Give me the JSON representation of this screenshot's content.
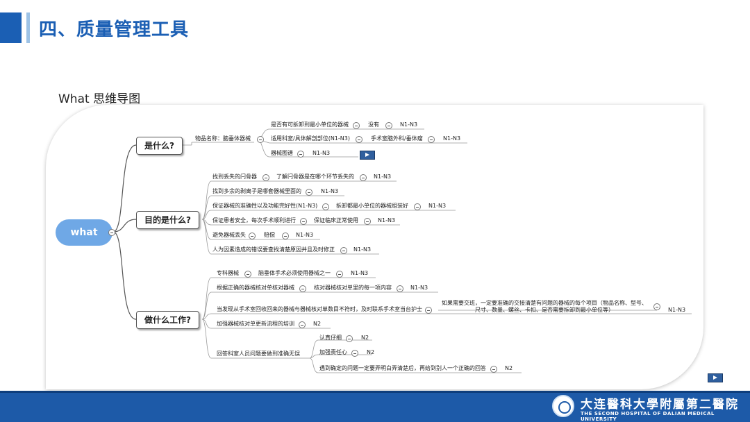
{
  "slide": {
    "title": "四、质量管理工具",
    "subtitle": "What 思维导图"
  },
  "mindmap": {
    "root": "what",
    "branch1": {
      "label": "是什么?",
      "item": "物品名称：脑垂体器械",
      "r1": "是否有可拆卸到最小单位的器械",
      "r1b": "没有",
      "r1c": "N1-N3",
      "r2": "适用科室/具体解剖部位(N1-N3)",
      "r2b": "手术室脑外科/垂体瘤",
      "r2c": "N1-N3",
      "r3": "器械图谱",
      "r3b": "N1-N3"
    },
    "branch2": {
      "label": "目的是什么?",
      "a1": "找到丢失的闩骨器",
      "a1b": "了解闩骨器是在哪个环节丢失的",
      "a1c": "N1-N3",
      "a2": "找到多余的剥离子是哪套器械里面的",
      "a2b": "N1-N3",
      "a3": "保证器械的准确性以及功能完好性(N1-N3)",
      "a3b": "拆卸都最小单位的器械组装好",
      "a3c": "N1-N3",
      "a4": "保证患者安全，每次手术顺利进行",
      "a4b": "保证临床正常使用",
      "a4c": "N1-N3",
      "a5": "避免器械丢失",
      "a5b": "赔偿",
      "a5c": "N1-N3",
      "a6": "人为因素造成的错误要查找清楚原因并且及时修正",
      "a6b": "N1-N3"
    },
    "branch3": {
      "label": "做什么工作?",
      "w1": "专科器械",
      "w1b": "脑垂体手术必须使用器械之一",
      "w1c": "N1-N3",
      "w2": "根据正确的器械核对单核对器械",
      "w2b": "核对器械核对单里的每一项内容",
      "w2c": "N1-N3",
      "w3": "当发现从手术室回收回来的器械与器械核对单数目不符时，及时联系手术室当台护士",
      "w3b1": "如果需要交班，一定要准确的交接清楚有问题的器械的每个项目（物品名称、型号、",
      "w3b2": "尺寸、数量、螺丝、卡扣、是否需要拆卸到最小单位等）",
      "w3c": "N1-N3",
      "w4": "加强器械核对单更新流程的培训",
      "w4b": "N2",
      "w5": "回答科室人员问题要做到准确无误",
      "w5a": "认真仔细",
      "w5ab": "N2",
      "w5b": "加强责任心",
      "w5bb": "N2",
      "w5c": "遇到确定的问题一定要弄明白弄清楚后，再给到别人一个正确的回答",
      "w5cb": "N2"
    }
  },
  "footer": {
    "logo_cn": "大连醫科大學附屬第二醫院",
    "logo_en": "THE SECOND HOSPITAL OF DALIAN MEDICAL UNIVERSITY"
  },
  "colors": {
    "brand_blue": "#1b5fb4",
    "footer_blue": "#1d5aa8",
    "root_node": "#6fa8e6"
  },
  "icons": [
    "collapse-toggle-icon",
    "play-flag-icon",
    "hospital-seal-icon"
  ]
}
